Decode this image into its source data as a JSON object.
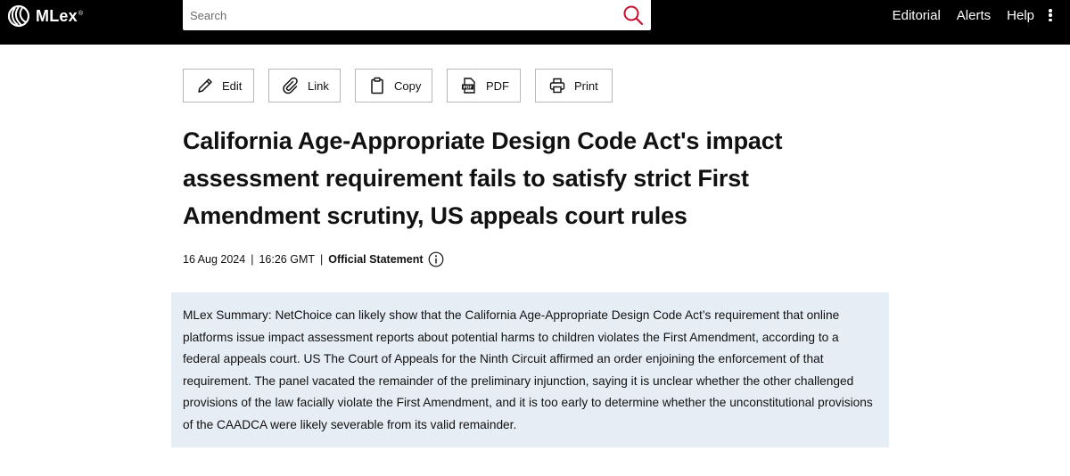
{
  "brand": {
    "name": "MLex",
    "mark": "®"
  },
  "search": {
    "placeholder": "Search",
    "value": "",
    "icon": "search-icon"
  },
  "nav": {
    "editorial": "Editorial",
    "alerts": "Alerts",
    "help": "Help",
    "more_icon": "more-vertical-icon"
  },
  "toolbar": {
    "edit": "Edit",
    "link": "Link",
    "copy": "Copy",
    "pdf": "PDF",
    "print": "Print"
  },
  "article": {
    "title": "California Age-Appropriate Design Code Act's impact assessment requirement fails to satisfy strict First Amendment scrutiny, US appeals court rules",
    "date": "16 Aug 2024",
    "time": "16:26 GMT",
    "separator": "|",
    "type": "Official Statement",
    "summary": "MLex Summary: NetChoice can likely show that the California Age-Appropriate Design Code Act’s requirement that online platforms issue impact assessment reports about potential harms to children violates the First Amendment, according to a federal appeals court. US The Court of Appeals for the Ninth Circuit affirmed an order enjoining the enforcement of that requirement. The panel vacated the remainder of the preliminary injunction, saying it is unclear whether the other challenged provisions of the law facially violate the First Amendment, and it is too early to determine whether the unconstitutional provisions of the CAADCA were likely severable from its valid remainder."
  },
  "colors": {
    "topbar": "#000000",
    "summary_bg": "#e6eef5",
    "search_icon": "#c8102e"
  }
}
